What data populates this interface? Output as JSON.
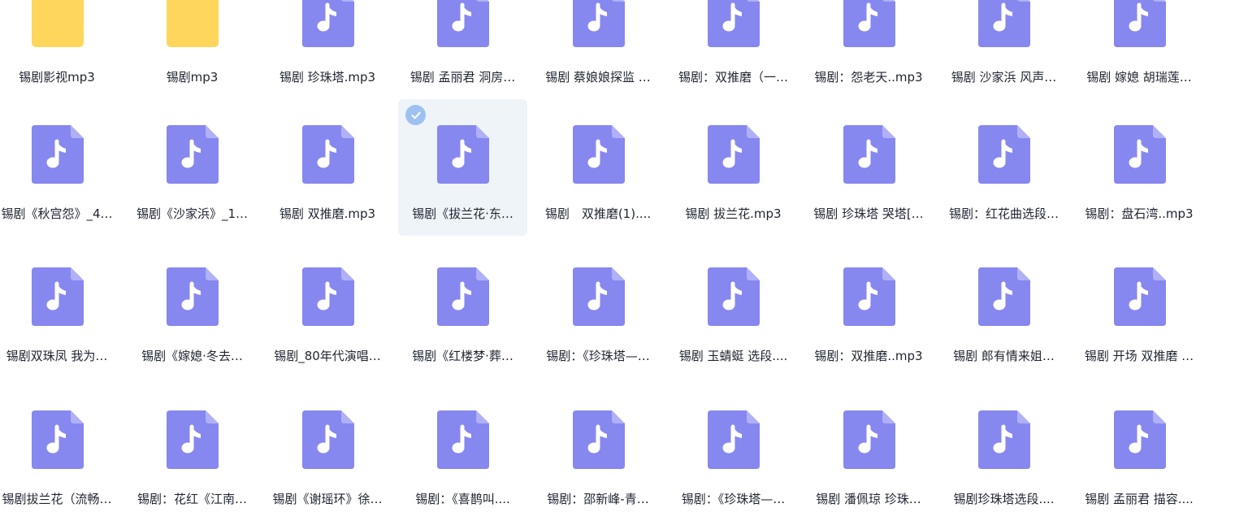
{
  "files": [
    {
      "name": "锡剧影视mp3",
      "type": "folder"
    },
    {
      "name": "锡剧mp3",
      "type": "folder"
    },
    {
      "name": "锡剧 珍珠塔.mp3",
      "type": "audio"
    },
    {
      "name": "锡剧 孟丽君 洞房…",
      "type": "audio"
    },
    {
      "name": "锡剧 蔡娘娘探监 …",
      "type": "audio"
    },
    {
      "name": "锡剧：双推磨（一…",
      "type": "audio"
    },
    {
      "name": "锡剧：怨老天..mp3",
      "type": "audio"
    },
    {
      "name": "锡剧 沙家浜 风声…",
      "type": "audio"
    },
    {
      "name": "锡剧 嫁媳 胡瑞莲…",
      "type": "audio"
    },
    {
      "name": "锡剧《秋宫怨》_4…",
      "type": "audio"
    },
    {
      "name": "锡剧《沙家浜》_1…",
      "type": "audio"
    },
    {
      "name": "锡剧 双推磨.mp3",
      "type": "audio"
    },
    {
      "name": "锡剧《拔兰花·东…",
      "type": "audio",
      "selected": true
    },
    {
      "name": "锡剧　双推磨(1)....",
      "type": "audio"
    },
    {
      "name": "锡剧 拔兰花.mp3",
      "type": "audio"
    },
    {
      "name": "锡剧 珍珠塔 哭塔[…",
      "type": "audio"
    },
    {
      "name": "锡剧：红花曲选段…",
      "type": "audio"
    },
    {
      "name": "锡剧：盘石湾..mp3",
      "type": "audio"
    },
    {
      "name": "锡剧双珠凤 我为…",
      "type": "audio"
    },
    {
      "name": "锡剧《嫁媳·冬去…",
      "type": "audio"
    },
    {
      "name": "锡剧_80年代演唱…",
      "type": "audio"
    },
    {
      "name": "锡剧《红楼梦·葬…",
      "type": "audio"
    },
    {
      "name": "锡剧：《珍珠塔—…",
      "type": "audio"
    },
    {
      "name": "锡剧 玉蜻蜓 选段....",
      "type": "audio"
    },
    {
      "name": "锡剧：双推磨..mp3",
      "type": "audio"
    },
    {
      "name": "锡剧 郎有情来姐…",
      "type": "audio"
    },
    {
      "name": "锡剧 开场 双推磨 …",
      "type": "audio"
    },
    {
      "name": "锡剧拔兰花（流畅…",
      "type": "audio"
    },
    {
      "name": "锡剧：花红《江南…",
      "type": "audio"
    },
    {
      "name": "锡剧《谢瑶环》徐…",
      "type": "audio"
    },
    {
      "name": "锡剧：《喜鹊叫....",
      "type": "audio"
    },
    {
      "name": "锡剧：邵新峰-青…",
      "type": "audio"
    },
    {
      "name": "锡剧：《珍珠塔—…",
      "type": "audio"
    },
    {
      "name": "锡剧 潘佩琼 珍珠…",
      "type": "audio"
    },
    {
      "name": "锡剧珍珠塔选段....",
      "type": "audio"
    },
    {
      "name": "锡剧 孟丽君 描容....",
      "type": "audio"
    }
  ],
  "colors": {
    "audio_icon": "#8787f0",
    "audio_fold": "#b0b0f7",
    "folder": "#ffd65c",
    "selected_bg": "#eff4f9",
    "check": "#9dc2f2"
  },
  "icons": {
    "audio": "music-file-icon",
    "folder": "folder-icon",
    "check": "check-circle-icon"
  }
}
